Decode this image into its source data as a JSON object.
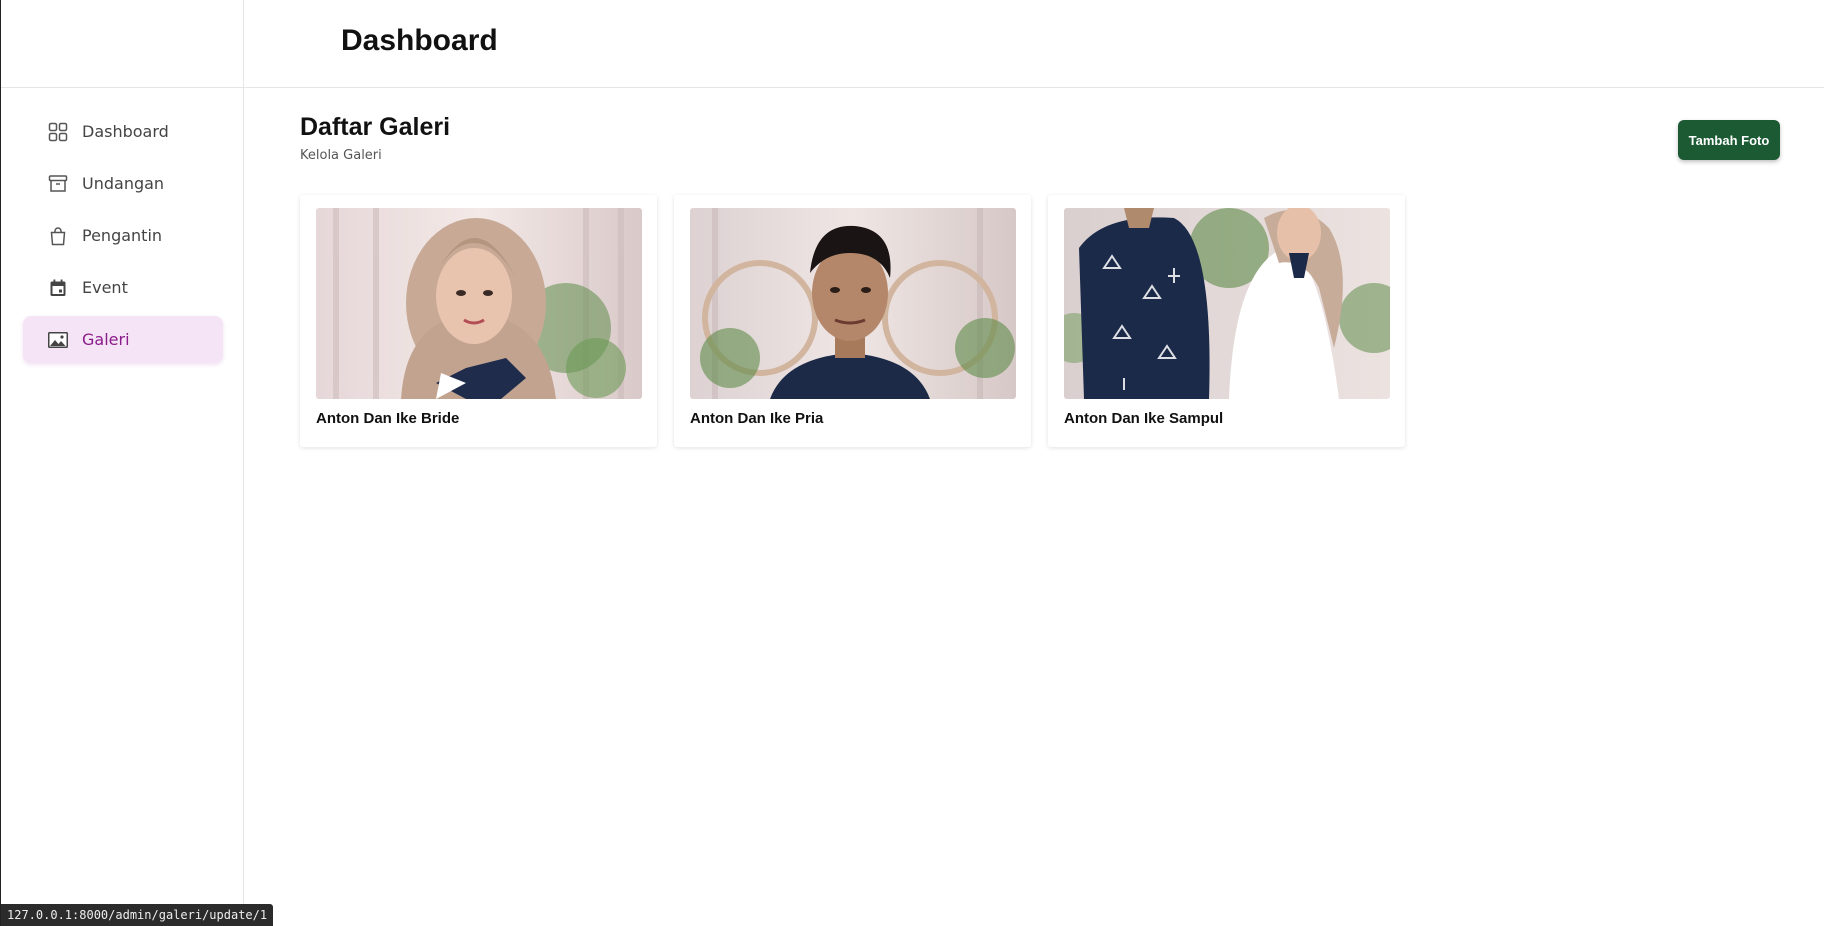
{
  "header": {
    "title": "Dashboard"
  },
  "sidebar": {
    "items": [
      {
        "label": "Dashboard",
        "icon": "grid-icon",
        "active": false
      },
      {
        "label": "Undangan",
        "icon": "archive-icon",
        "active": false
      },
      {
        "label": "Pengantin",
        "icon": "shopping-bag-icon",
        "active": false
      },
      {
        "label": "Event",
        "icon": "calendar-icon",
        "active": false
      },
      {
        "label": "Galeri",
        "icon": "image-icon",
        "active": true
      }
    ]
  },
  "main": {
    "title": "Daftar Galeri",
    "subtitle": "Kelola Galeri",
    "add_button_label": "Tambah Foto",
    "gallery": [
      {
        "caption": "Anton Dan Ike Bride"
      },
      {
        "caption": "Anton Dan Ike Pria"
      },
      {
        "caption": "Anton Dan Ike Sampul"
      }
    ]
  },
  "status_bar": {
    "url": "127.0.0.1:8000/admin/galeri/update/1"
  },
  "colors": {
    "accent": "#8a1b8a",
    "active_bg": "#f5e4f6",
    "primary_button": "#1c5a34"
  }
}
